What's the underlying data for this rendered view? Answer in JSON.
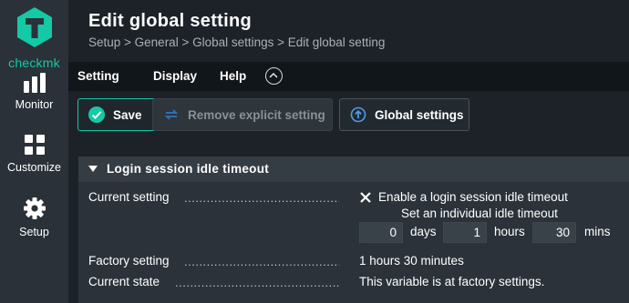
{
  "app": {
    "logo_text": "checkmk",
    "brand_color": "#14c9a5"
  },
  "sidebar": {
    "items": [
      {
        "label": "Monitor",
        "icon": "bar-chart-icon"
      },
      {
        "label": "Customize",
        "icon": "grid-icon"
      },
      {
        "label": "Setup",
        "icon": "gear-icon"
      }
    ]
  },
  "header": {
    "title": "Edit global setting",
    "breadcrumb": "Setup > General > Global settings > Edit global setting"
  },
  "menubar": {
    "items": [
      "Setting",
      "Display",
      "Help"
    ],
    "collapse_icon": "chevron-up-icon"
  },
  "toolbar": {
    "save_label": "Save",
    "remove_label": "Remove explicit setting",
    "global_label": "Global settings"
  },
  "section": {
    "title": "Login session idle timeout",
    "current_setting_label": "Current setting",
    "checkbox_label": "Enable a login session idle timeout",
    "individual_label": "Set an individual idle timeout",
    "days_value": "0",
    "days_unit": "days",
    "hours_value": "1",
    "hours_unit": "hours",
    "mins_value": "30",
    "mins_unit": "mins",
    "factory_label": "Factory setting",
    "factory_value": "1 hours 30 minutes",
    "state_label": "Current state",
    "state_value": "This variable is at factory settings."
  }
}
